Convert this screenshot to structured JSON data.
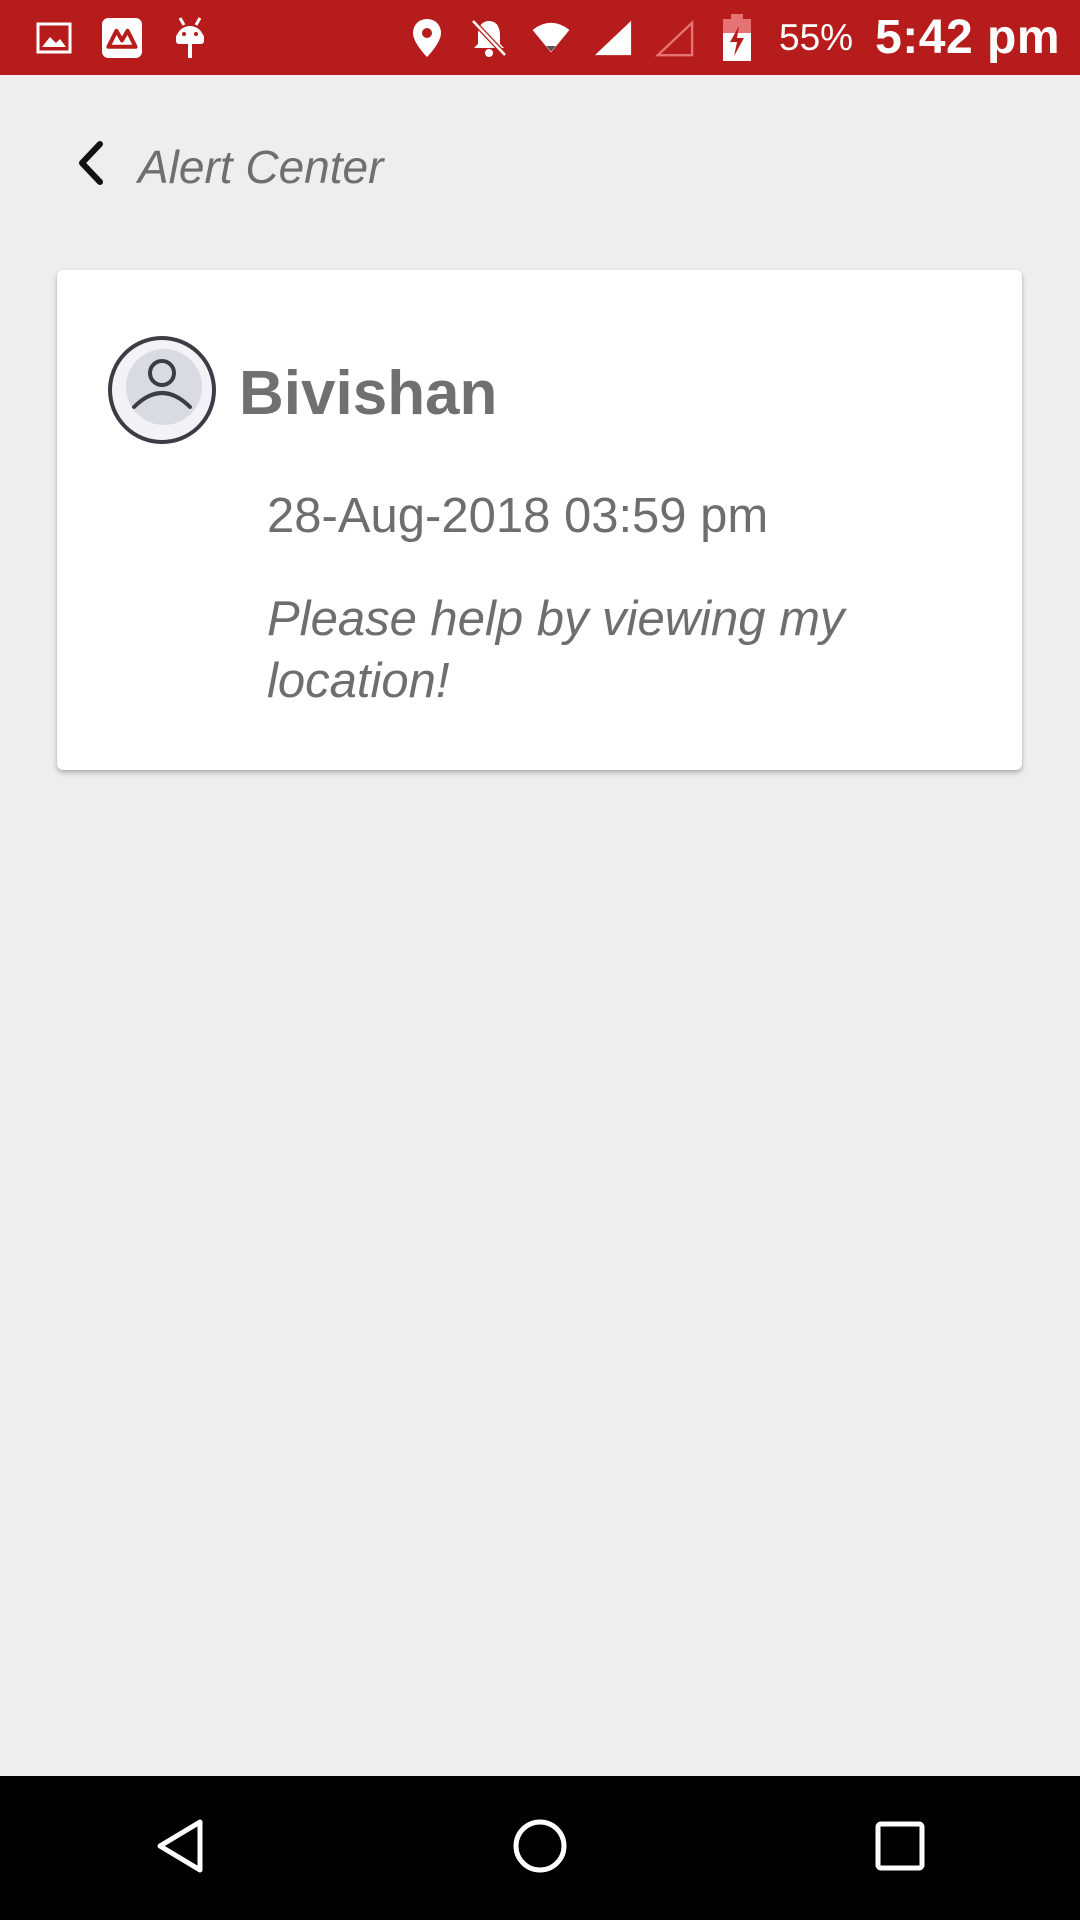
{
  "status_bar": {
    "battery_percent": "55%",
    "time": "5:42 pm",
    "color": "#b71c1c",
    "left_icons": [
      "gallery-icon",
      "app-logo-icon",
      "android-debug-icon"
    ],
    "right_icons": [
      "location-icon",
      "notifications-off-icon",
      "wifi-icon",
      "signal-icon",
      "signal-empty-icon",
      "battery-charging-icon"
    ]
  },
  "header": {
    "title": "Alert Center",
    "back_icon": "chevron-left-icon"
  },
  "alert": {
    "sender": "Bivishan",
    "timestamp": "28-Aug-2018 03:59 pm",
    "message": "Please help by viewing my location!",
    "avatar_icon": "user-avatar-icon"
  },
  "nav_bar": {
    "buttons": [
      "back-triangle-icon",
      "home-circle-icon",
      "recents-square-icon"
    ]
  }
}
